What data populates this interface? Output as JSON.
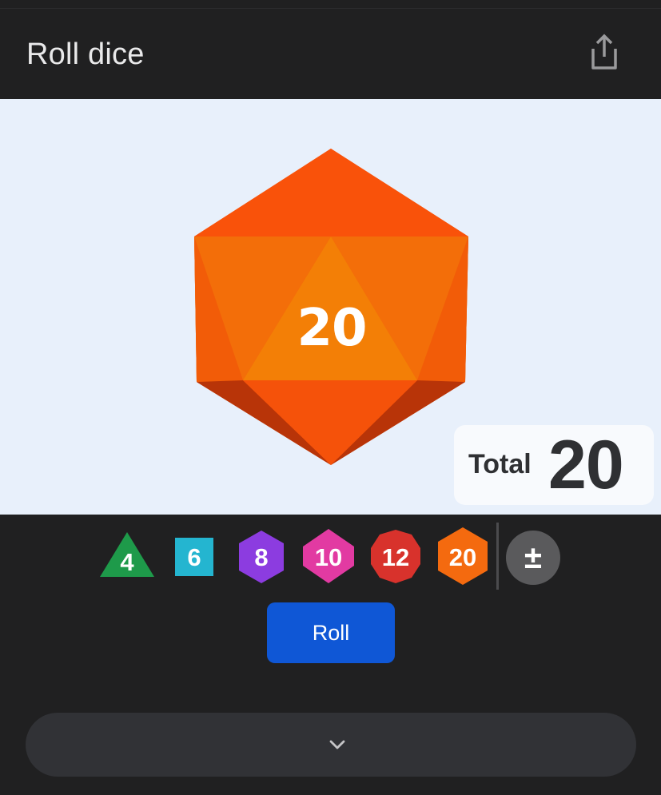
{
  "header": {
    "title": "Roll dice",
    "share_icon": "share-icon"
  },
  "stage": {
    "rolled_die": "d20",
    "rolled_value": "20",
    "total_label": "Total",
    "total_value": "20"
  },
  "dice": [
    {
      "label": "4",
      "sides": 4,
      "color": "#1e9a4a",
      "shape": "triangle"
    },
    {
      "label": "6",
      "sides": 6,
      "color": "#24b5d0",
      "shape": "square"
    },
    {
      "label": "8",
      "sides": 8,
      "color": "#8c3ce0",
      "shape": "hexagon"
    },
    {
      "label": "10",
      "sides": 10,
      "color": "#e23aa2",
      "shape": "diamond-hex"
    },
    {
      "label": "12",
      "sides": 12,
      "color": "#d8322c",
      "shape": "decagon"
    },
    {
      "label": "20",
      "sides": 20,
      "color": "#f46a0f",
      "shape": "hexagon"
    }
  ],
  "modifier_button": {
    "label": "±"
  },
  "roll_button": {
    "label": "Roll"
  },
  "expand": {
    "icon": "chevron-down-icon"
  },
  "colors": {
    "background": "#202021",
    "stage": "#e8f0fb",
    "roll_button": "#0f57d6",
    "d20_main": "#f45a0a"
  }
}
